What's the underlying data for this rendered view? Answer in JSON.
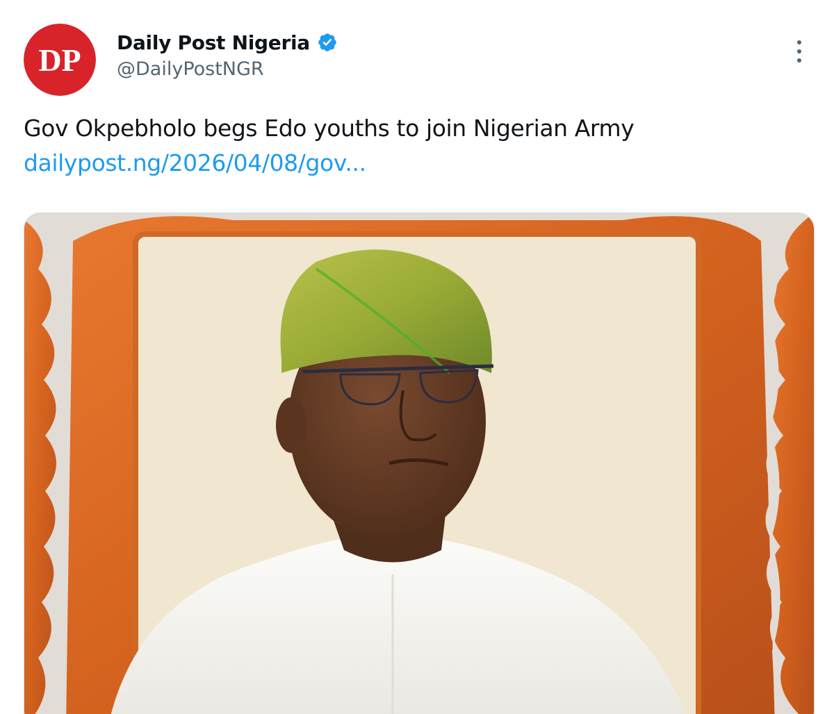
{
  "account": {
    "display_name": "Daily Post Nigeria",
    "handle": "@DailyPostNGR",
    "avatar_text": "DP",
    "verified": true,
    "avatar_color": "#d8232a"
  },
  "tweet": {
    "text": "Gov Okpebholo begs Edo youths to join Nigerian Army",
    "link_text": "dailypost.ng/2026/04/08/gov...",
    "link_color": "#1d9bf0"
  },
  "icons": {
    "more": "more-vertical-icon",
    "verified": "verified-badge-icon"
  }
}
